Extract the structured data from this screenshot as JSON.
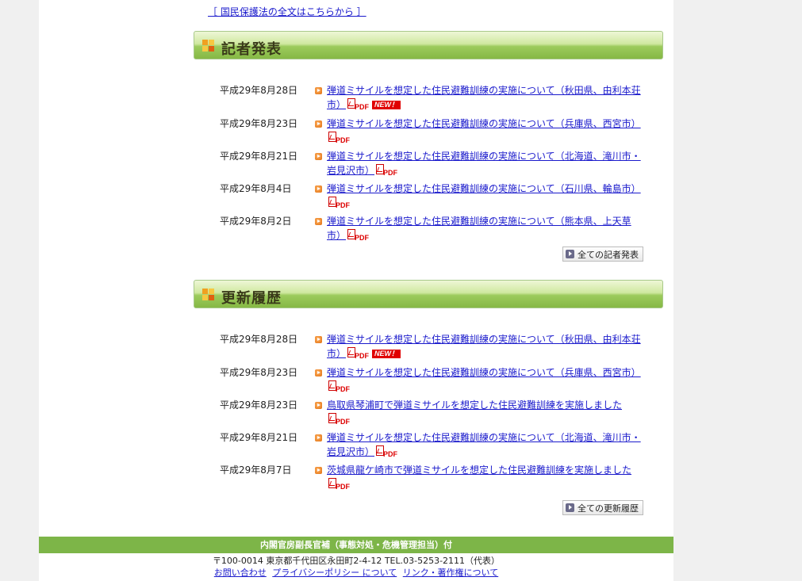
{
  "top": {
    "link": "［ 国民保護法の全文はこちらから ］"
  },
  "colors": {
    "accent": "#7db548",
    "link": "#1a1acc",
    "new_badge": "#e00000"
  },
  "press": {
    "title": "記者発表",
    "items": [
      {
        "date": "平成29年8月28日",
        "text": "弾道ミサイルを想定した住民避難訓練の実施について（秋田県、由利本荘市）",
        "pdf": "PDF",
        "new": "NEW！"
      },
      {
        "date": "平成29年8月23日",
        "text": "弾道ミサイルを想定した住民避難訓練の実施について（兵庫県、西宮市）",
        "pdf": "PDF"
      },
      {
        "date": "平成29年8月21日",
        "text": "弾道ミサイルを想定した住民避難訓練の実施について（北海道、滝川市・岩見沢市）",
        "pdf": "PDF"
      },
      {
        "date": "平成29年8月4日",
        "text": "弾道ミサイルを想定した住民避難訓練の実施について（石川県、輪島市）",
        "pdf": "PDF"
      },
      {
        "date": "平成29年8月2日",
        "text": "弾道ミサイルを想定した住民避難訓練の実施について（熊本県、上天草市）",
        "pdf": "PDF"
      }
    ],
    "all_button": "全ての記者発表"
  },
  "history": {
    "title": "更新履歴",
    "items": [
      {
        "date": "平成29年8月28日",
        "text": "弾道ミサイルを想定した住民避難訓練の実施について（秋田県、由利本荘市）",
        "pdf": "PDF",
        "new": "NEW！"
      },
      {
        "date": "平成29年8月23日",
        "text": "弾道ミサイルを想定した住民避難訓練の実施について（兵庫県、西宮市）",
        "pdf": "PDF"
      },
      {
        "date": "平成29年8月23日",
        "text": "鳥取県琴浦町で弾道ミサイルを想定した住民避難訓練を実施しました",
        "pdf": "PDF"
      },
      {
        "date": "平成29年8月21日",
        "text": "弾道ミサイルを想定した住民避難訓練の実施について（北海道、滝川市・岩見沢市）",
        "pdf": "PDF"
      },
      {
        "date": "平成29年8月7日",
        "text": "茨城県龍ケ崎市で弾道ミサイルを想定した住民避難訓練を実施しました",
        "pdf": "PDF"
      }
    ],
    "all_button": "全ての更新履歴"
  },
  "footer": {
    "org": "内閣官房副長官補（事態対処・危機管理担当）付",
    "address": "〒100-0014 東京都千代田区永田町2-4-12 TEL.03-5253-2111（代表）",
    "links": [
      "お問い合わせ",
      "プライバシーポリシー について",
      "リンク・著作権について"
    ]
  }
}
